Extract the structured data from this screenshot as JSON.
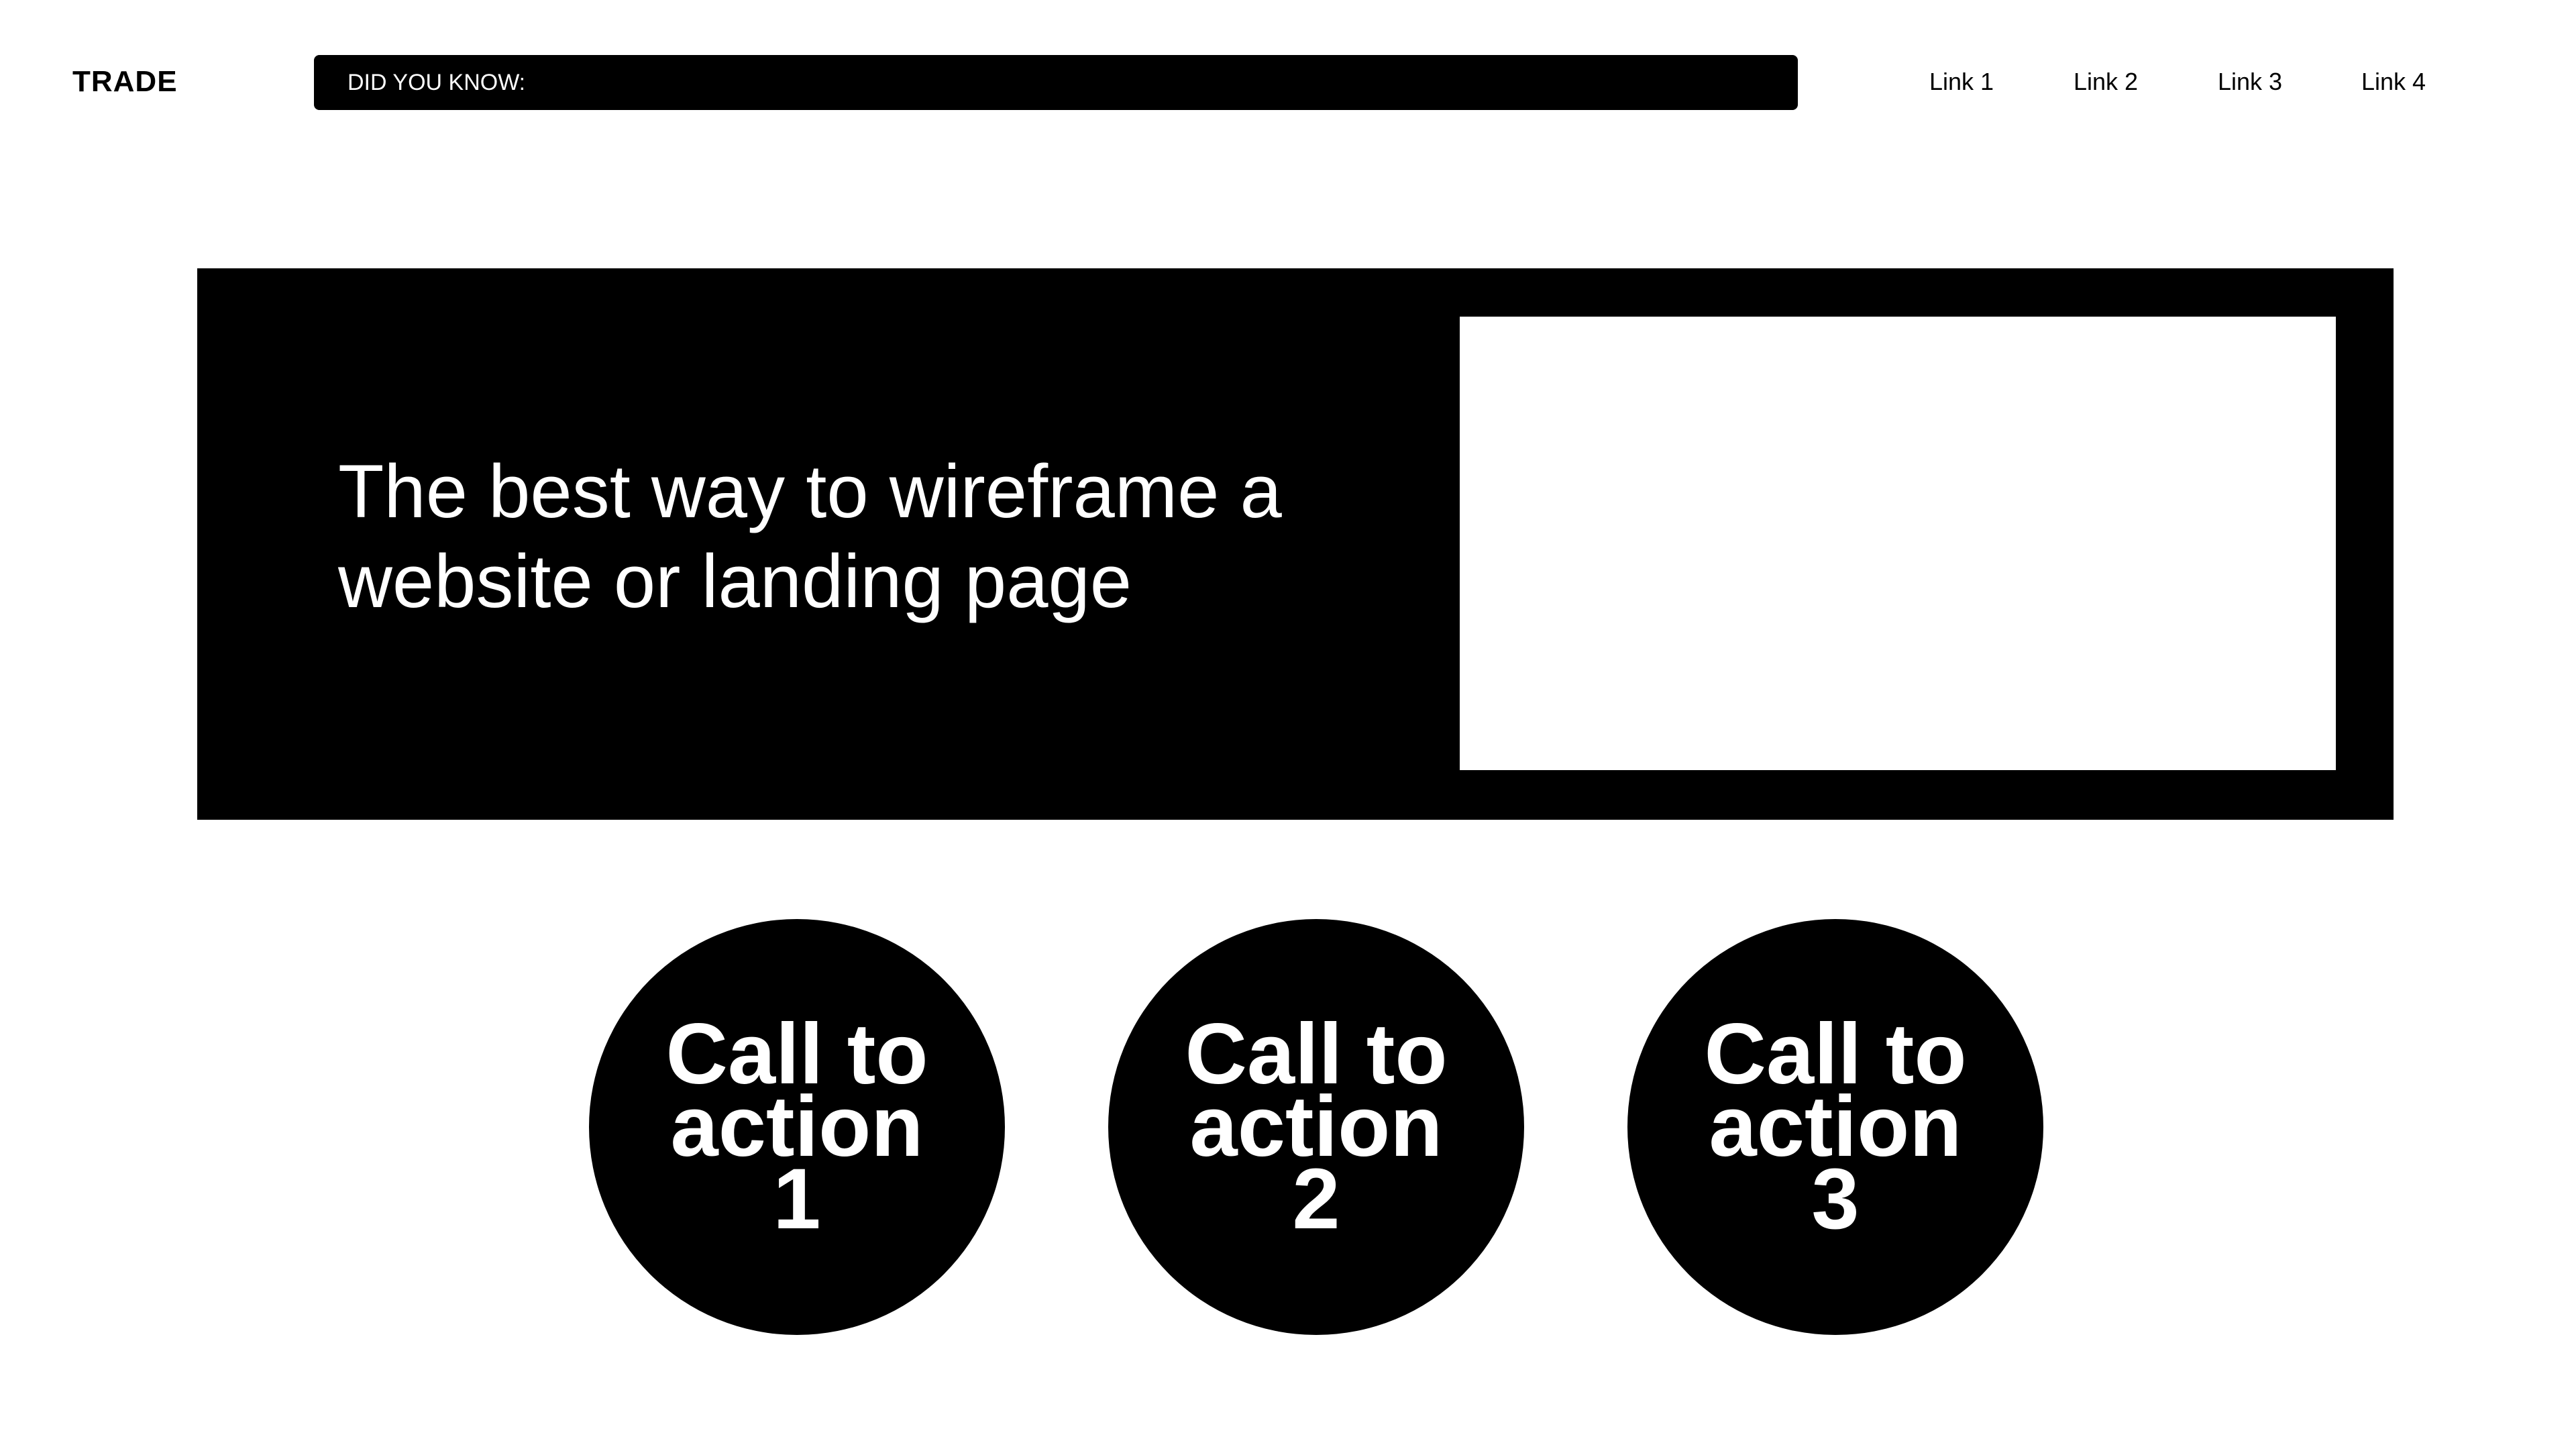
{
  "header": {
    "logo": "TRADE",
    "ticker_label": "DID YOU KNOW:",
    "nav": [
      {
        "label": "Link 1"
      },
      {
        "label": "Link 2"
      },
      {
        "label": "Link 3"
      },
      {
        "label": "Link 4"
      }
    ]
  },
  "hero": {
    "headline": "The best way to wireframe a website or landing page"
  },
  "ctas": [
    {
      "label": "Call to action 1"
    },
    {
      "label": "Call to action 2"
    },
    {
      "label": "Call to action 3"
    }
  ],
  "colors": {
    "background": "#ffffff",
    "foreground": "#000000",
    "inverse_text": "#ffffff"
  }
}
